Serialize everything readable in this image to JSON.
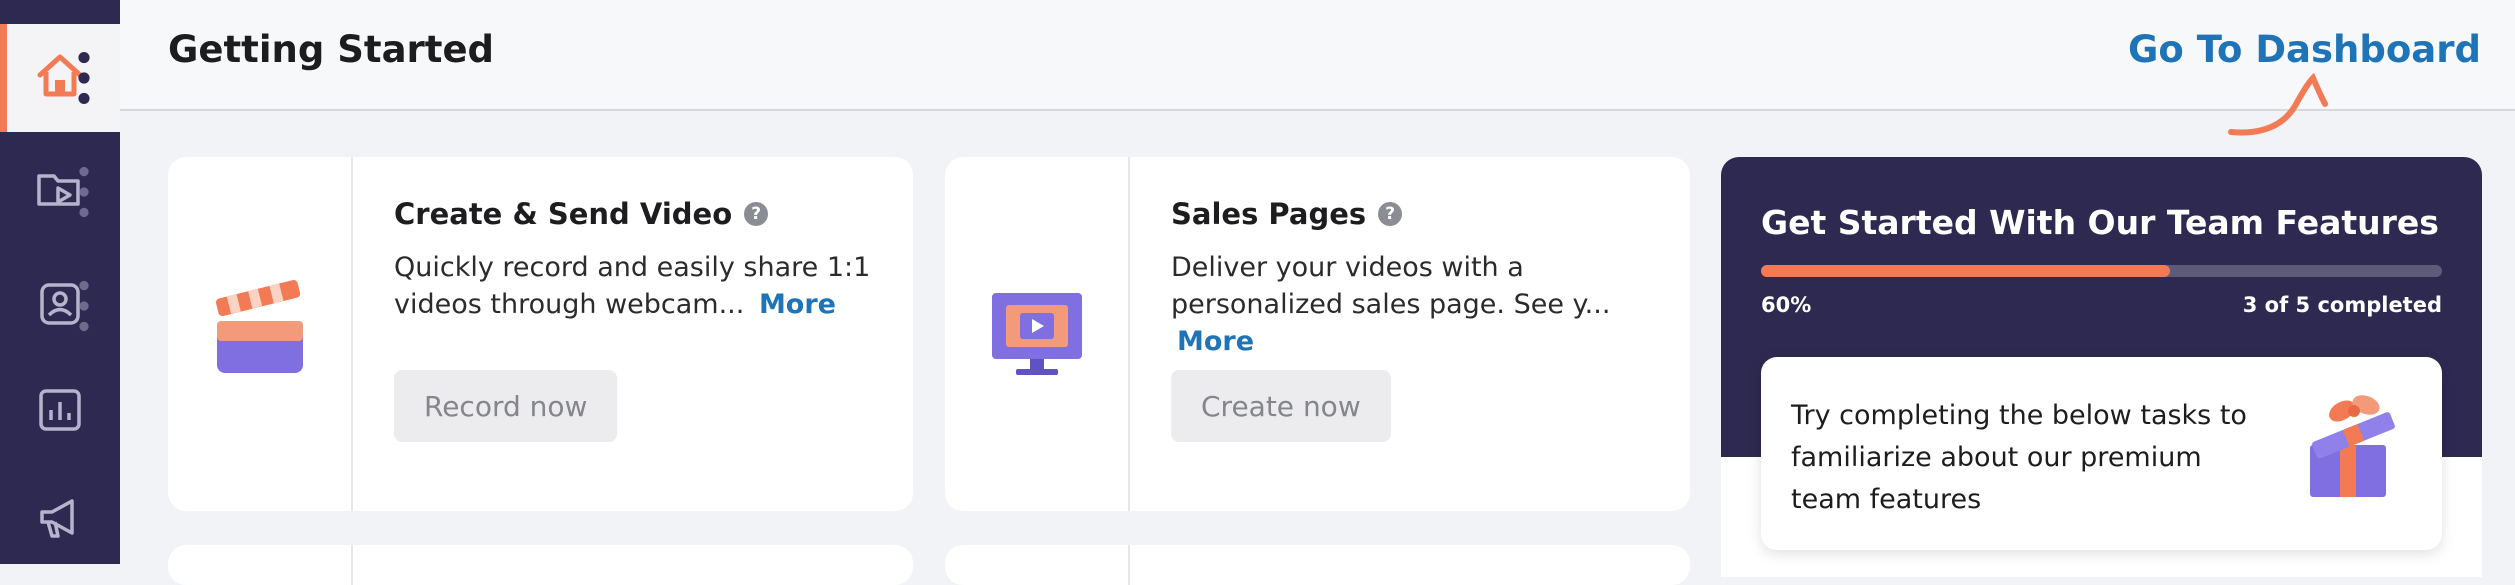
{
  "header": {
    "title": "Getting Started",
    "dashboard_link": "Go To Dashboard"
  },
  "sidebar": {
    "items": [
      {
        "icon": "home-icon",
        "active": true
      },
      {
        "icon": "video-folder-icon",
        "active": false
      },
      {
        "icon": "contact-icon",
        "active": false
      },
      {
        "icon": "analytics-icon",
        "active": false
      },
      {
        "icon": "megaphone-icon",
        "active": false
      }
    ]
  },
  "cards": [
    {
      "icon": "clapperboard-icon",
      "title": "Create & Send Video",
      "description": "Quickly record and easily share 1:1 videos through webcam...",
      "more_label": "More",
      "button_label": "Record now"
    },
    {
      "icon": "monitor-play-icon",
      "title": "Sales Pages",
      "description": "Deliver your videos with a personalized sales page. See y...",
      "more_label": "More",
      "button_label": "Create now"
    }
  ],
  "team_features": {
    "title": "Get Started With Our Team Features",
    "progress": {
      "fraction": 0.6,
      "percent_label": "60%",
      "count_label": "3 of 5 completed"
    },
    "task_text": "Try completing the below tasks to familiarize about our premium team features",
    "icon": "gift-icon"
  },
  "colors": {
    "sidebar_bg": "#2d2950",
    "accent_orange": "#f27a54",
    "link_blue": "#1f73b7",
    "page_bg": "#f1f3f6"
  }
}
